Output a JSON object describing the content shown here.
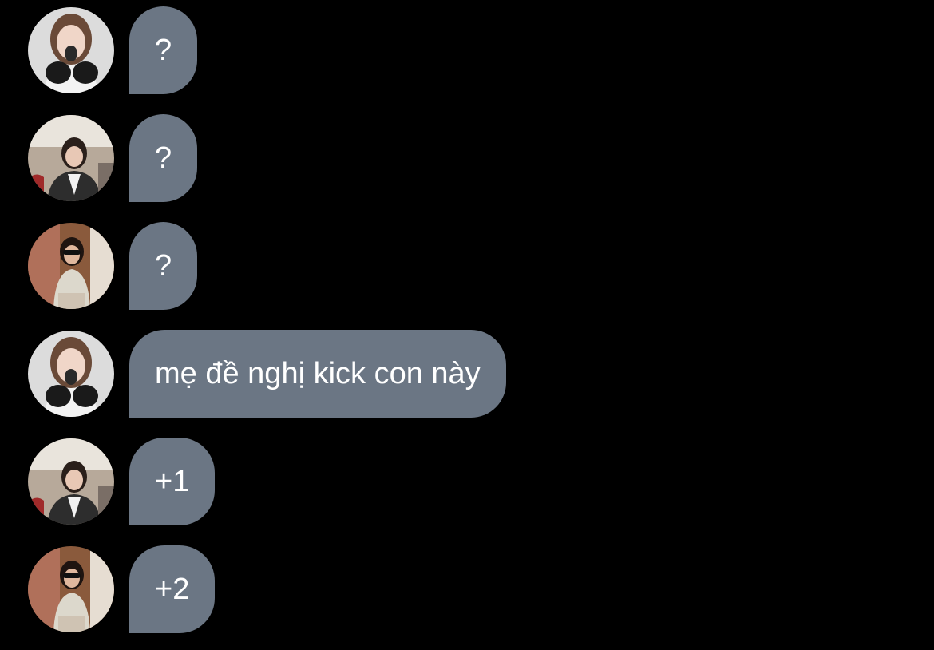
{
  "messages": [
    {
      "avatar": "avatar-girl-white",
      "text": "?"
    },
    {
      "avatar": "avatar-girl-blazer",
      "text": "?"
    },
    {
      "avatar": "avatar-girl-sunglasses",
      "text": "?"
    },
    {
      "avatar": "avatar-girl-white",
      "text": "mẹ đề nghị kick con này"
    },
    {
      "avatar": "avatar-girl-blazer",
      "text": "+1"
    },
    {
      "avatar": "avatar-girl-sunglasses",
      "text": "+2"
    }
  ],
  "colors": {
    "background": "#000000",
    "bubble": "#6b7684",
    "text": "#ffffff"
  }
}
